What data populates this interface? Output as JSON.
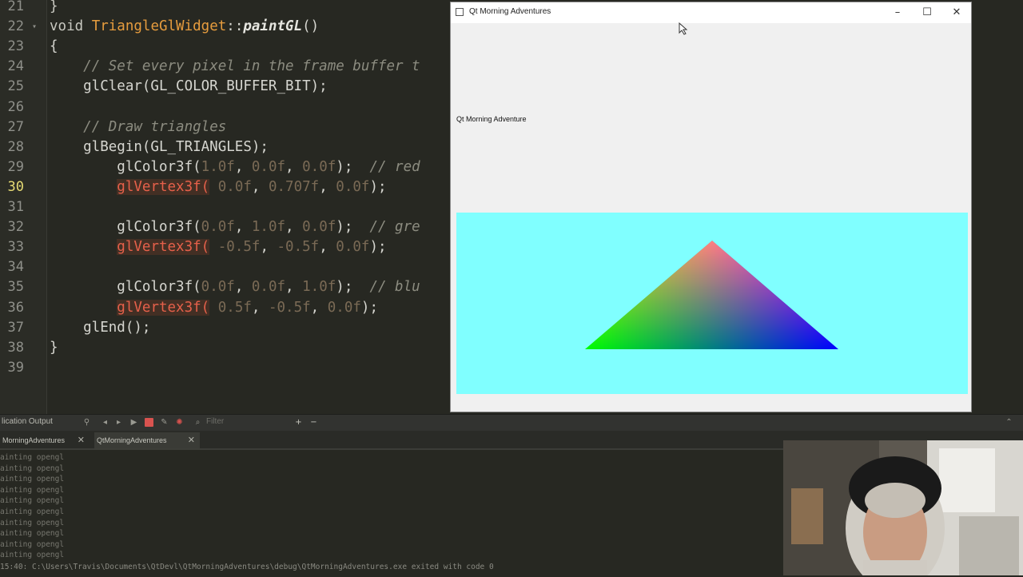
{
  "editor": {
    "lines": [
      {
        "n": "21",
        "html": "<span class=\"kw\">}</span>",
        "fold": false
      },
      {
        "n": "22",
        "html": "<span class=\"kw\">void</span> <span class=\"cls\">TriangleGlWidget</span>::<span class=\"fn\">paintGL</span>()",
        "fold": true
      },
      {
        "n": "23",
        "html": "{",
        "fold": false
      },
      {
        "n": "24",
        "html": "    <span class=\"cmt\">// Set every pixel in the frame buffer t</span>",
        "fold": false
      },
      {
        "n": "25",
        "html": "    glClear(GL_COLOR_BUFFER_BIT);",
        "fold": false
      },
      {
        "n": "26",
        "html": "",
        "fold": false
      },
      {
        "n": "27",
        "html": "    <span class=\"cmt\">// Draw triangles</span>",
        "fold": false
      },
      {
        "n": "28",
        "html": "    glBegin(GL_TRIANGLES);",
        "fold": false
      },
      {
        "n": "29",
        "html": "        glColor3f(<span class=\"num\">1.0f</span>, <span class=\"num\">0.0f</span>, <span class=\"num\">0.0f</span>);  <span class=\"cmt\">// red</span>",
        "fold": false
      },
      {
        "n": "30",
        "html": "        <span class=\"call-hl\">glVertex3f(</span> <span class=\"num\">0.0f</span>, <span class=\"num\">0.707f</span>, <span class=\"num\">0.0f</span>);",
        "fold": false,
        "current": true
      },
      {
        "n": "31",
        "html": "",
        "fold": false
      },
      {
        "n": "32",
        "html": "        glColor3f(<span class=\"num\">0.0f</span>, <span class=\"num\">1.0f</span>, <span class=\"num\">0.0f</span>);  <span class=\"cmt\">// gre</span>",
        "fold": false
      },
      {
        "n": "33",
        "html": "        <span class=\"call-hl\">glVertex3f(</span> <span class=\"num\">-0.5f</span>, <span class=\"num\">-0.5f</span>, <span class=\"num\">0.0f</span>);",
        "fold": false
      },
      {
        "n": "34",
        "html": "",
        "fold": false
      },
      {
        "n": "35",
        "html": "        glColor3f(<span class=\"num\">0.0f</span>, <span class=\"num\">0.0f</span>, <span class=\"num\">1.0f</span>);  <span class=\"cmt\">// blu</span>",
        "fold": false
      },
      {
        "n": "36",
        "html": "        <span class=\"call-hl\">glVertex3f(</span> <span class=\"num\">0.5f</span>, <span class=\"num\">-0.5f</span>, <span class=\"num\">0.0f</span>);",
        "fold": false
      },
      {
        "n": "37",
        "html": "    glEnd();",
        "fold": false
      },
      {
        "n": "38",
        "html": "}",
        "fold": false
      },
      {
        "n": "39",
        "html": "",
        "fold": false
      }
    ]
  },
  "app_window": {
    "title": "Qt Morning Adventures",
    "minimize_glyph": "–",
    "maximize_glyph": "☐",
    "close_glyph": "✕",
    "label": "Qt Morning Adventure",
    "gl_clear_color": "#80ffff",
    "triangle_colors": {
      "top": "#ff0000",
      "left": "#00ff00",
      "right": "#0000ff"
    }
  },
  "output_panel": {
    "title": "lication Output",
    "filter_placeholder": "Filter",
    "tabs": [
      {
        "label": "MorningAdventures",
        "close": "✕",
        "active": false
      },
      {
        "label": "QtMorningAdventures",
        "close": "✕",
        "active": true
      }
    ],
    "lines": [
      "ainting opengl",
      "ainting opengl",
      "ainting opengl",
      "ainting opengl",
      "ainting opengl",
      "ainting opengl",
      "ainting opengl",
      "ainting opengl",
      "ainting opengl",
      "ainting opengl"
    ],
    "exit_line": "15:40: C:\\Users\\Travis\\Documents\\QtDevl\\QtMorningAdventures\\debug\\QtMorningAdventures.exe exited with code 0"
  }
}
